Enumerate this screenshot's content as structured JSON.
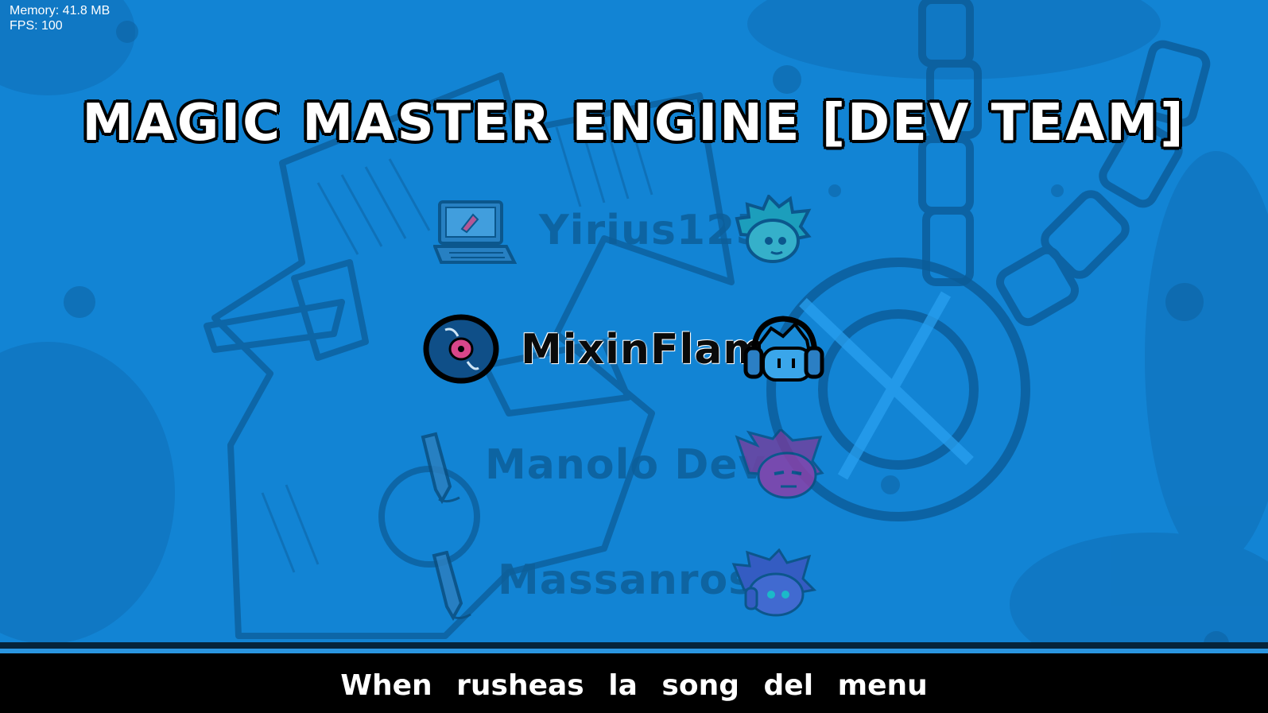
{
  "debug": {
    "memory": "Memory: 41.8 MB",
    "fps": "FPS: 100"
  },
  "title": {
    "main": "MAGIC MASTER ENGINE ",
    "bracket_open": "[",
    "team": "DEV TEAM",
    "bracket_close": "]"
  },
  "credits": [
    {
      "name": "Yirius125",
      "role_icon": "laptop-icon",
      "avatar": "green-spiky-hair-avatar",
      "selected": false
    },
    {
      "name": "MixinFlame",
      "role_icon": "vinyl-disc-icon",
      "avatar": "headphones-avatar",
      "selected": true
    },
    {
      "name": "Manolo Dev",
      "role_icon": "pencil-icon",
      "avatar": "purple-hair-avatar",
      "selected": false
    },
    {
      "name": "Massanross",
      "role_icon": "pencil-icon",
      "avatar": "blue-hair-avatar",
      "selected": false
    }
  ],
  "footer": {
    "text": "When rusheas la song del menu"
  },
  "colors": {
    "background": "#1284d4",
    "dim_text": "#0e5f99",
    "footer_bg": "#000000"
  }
}
